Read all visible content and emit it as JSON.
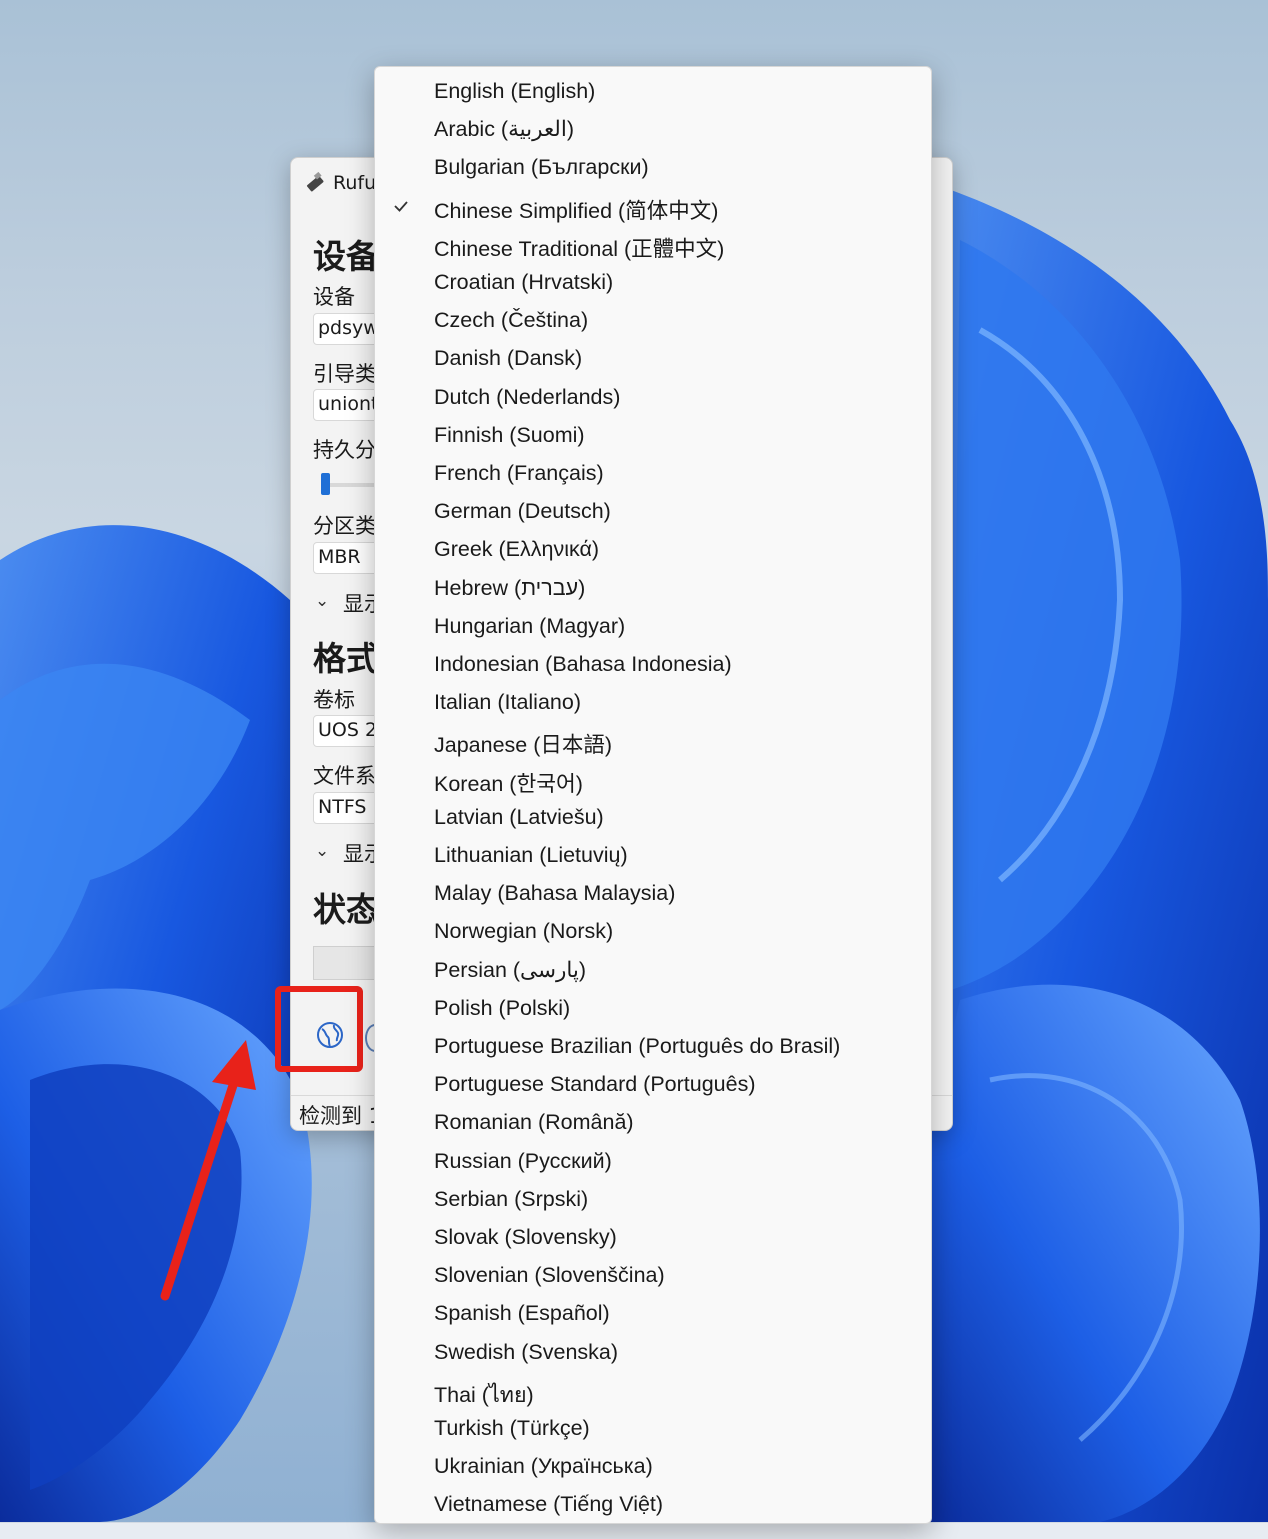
{
  "rufus": {
    "title": "Rufu",
    "device_heading": "设备",
    "device_label": "设备",
    "device_value": "pdsyw",
    "boot_label": "引导类",
    "boot_value": "uniont",
    "persist_label": "持久分",
    "partition_label": "分区类",
    "partition_value": "MBR",
    "show_more_1": "显示",
    "format_heading": "格式",
    "volume_label": "卷标",
    "volume_value": "UOS 2",
    "fs_label": "文件系",
    "fs_value": "NTFS",
    "show_more_2": "显示",
    "status_heading": "状态",
    "status_text": "检测到 1"
  },
  "language_menu": {
    "selected": "Chinese Simplified (简体中文)",
    "items": [
      {
        "label": "English (English)",
        "checked": false
      },
      {
        "label": "Arabic (العربية)",
        "checked": false
      },
      {
        "label": "Bulgarian (Български)",
        "checked": false
      },
      {
        "label": "Chinese Simplified (简体中文)",
        "checked": true
      },
      {
        "label": "Chinese Traditional (正體中文)",
        "checked": false
      },
      {
        "label": "Croatian (Hrvatski)",
        "checked": false
      },
      {
        "label": "Czech (Čeština)",
        "checked": false
      },
      {
        "label": "Danish (Dansk)",
        "checked": false
      },
      {
        "label": "Dutch (Nederlands)",
        "checked": false
      },
      {
        "label": "Finnish (Suomi)",
        "checked": false
      },
      {
        "label": "French (Français)",
        "checked": false
      },
      {
        "label": "German (Deutsch)",
        "checked": false
      },
      {
        "label": "Greek (Ελληνικά)",
        "checked": false
      },
      {
        "label": "Hebrew (עברית)",
        "checked": false
      },
      {
        "label": "Hungarian (Magyar)",
        "checked": false
      },
      {
        "label": "Indonesian (Bahasa Indonesia)",
        "checked": false
      },
      {
        "label": "Italian (Italiano)",
        "checked": false
      },
      {
        "label": "Japanese (日本語)",
        "checked": false
      },
      {
        "label": "Korean (한국어)",
        "checked": false
      },
      {
        "label": "Latvian (Latviešu)",
        "checked": false
      },
      {
        "label": "Lithuanian (Lietuvių)",
        "checked": false
      },
      {
        "label": "Malay (Bahasa Malaysia)",
        "checked": false
      },
      {
        "label": "Norwegian (Norsk)",
        "checked": false
      },
      {
        "label": "Persian (پارسی)",
        "checked": false
      },
      {
        "label": "Polish (Polski)",
        "checked": false
      },
      {
        "label": "Portuguese Brazilian (Português do Brasil)",
        "checked": false
      },
      {
        "label": "Portuguese Standard (Português)",
        "checked": false
      },
      {
        "label": "Romanian (Română)",
        "checked": false
      },
      {
        "label": "Russian (Русский)",
        "checked": false
      },
      {
        "label": "Serbian (Srpski)",
        "checked": false
      },
      {
        "label": "Slovak (Slovensky)",
        "checked": false
      },
      {
        "label": "Slovenian (Slovenščina)",
        "checked": false
      },
      {
        "label": "Spanish (Español)",
        "checked": false
      },
      {
        "label": "Swedish (Svenska)",
        "checked": false
      },
      {
        "label": "Thai (ไทย)",
        "checked": false
      },
      {
        "label": "Turkish (Türkçe)",
        "checked": false
      },
      {
        "label": "Ukrainian (Українська)",
        "checked": false
      },
      {
        "label": "Vietnamese (Tiếng Việt)",
        "checked": false
      }
    ]
  },
  "icons": {
    "language": "globe-icon",
    "check": "checkmark-icon",
    "app": "usb-drive-icon",
    "expand": "chevron-down-icon"
  },
  "colors": {
    "highlight": "#e8221a",
    "accent": "#1f6fd6"
  }
}
